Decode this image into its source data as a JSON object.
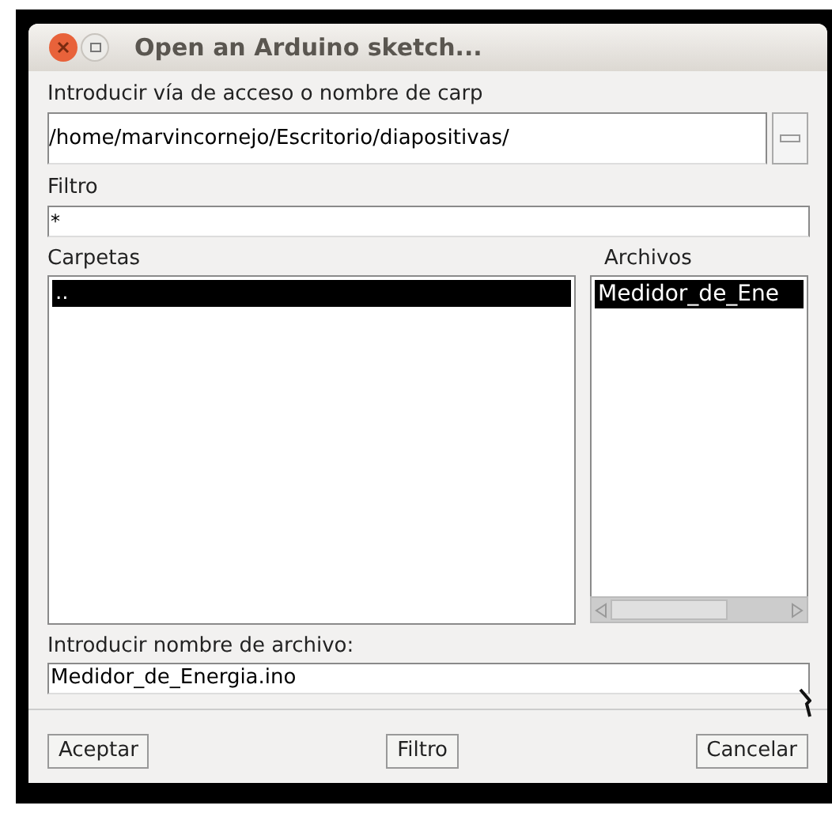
{
  "window": {
    "title": "Open an Arduino sketch..."
  },
  "path": {
    "label": "Introducir vía de acceso o nombre de carp",
    "value": "/home/marvincornejo/Escritorio/diapositivas/"
  },
  "filter": {
    "label": "Filtro",
    "value": "*"
  },
  "folders": {
    "label": "Carpetas",
    "items": [
      {
        "name": "..",
        "selected": true
      }
    ]
  },
  "files": {
    "label": "Archivos",
    "items": [
      {
        "name": "Medidor_de_Ene",
        "selected": true
      }
    ]
  },
  "filename": {
    "label": "Introducir nombre de archivo:",
    "value": "Medidor_de_Energia.ino"
  },
  "buttons": [
    "Aceptar",
    "Filtro",
    "Cancelar"
  ]
}
